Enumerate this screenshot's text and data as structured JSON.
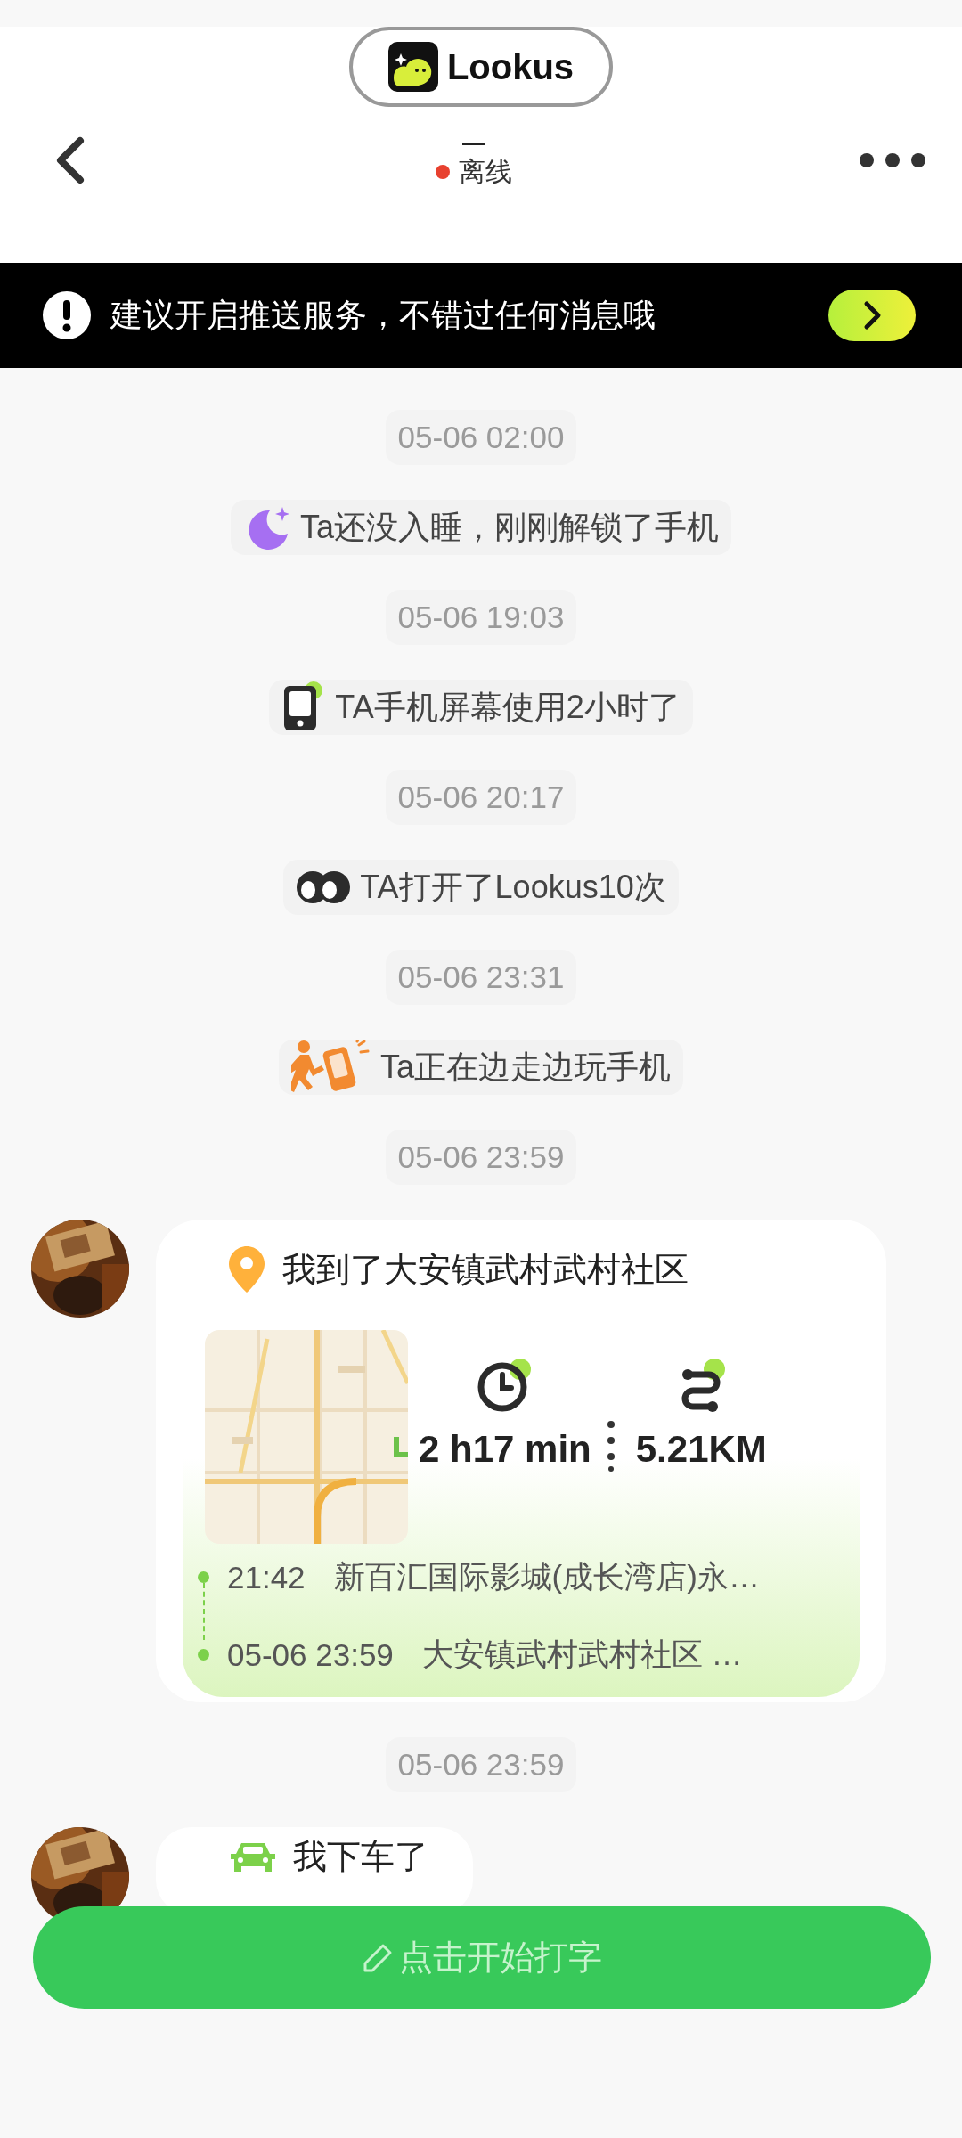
{
  "app_badge": {
    "name": "Lookus"
  },
  "header": {
    "contact_name": "—",
    "status": "离线",
    "online": false
  },
  "banner": {
    "text": "建议开启推送服务，不错过任何消息哦"
  },
  "feed": [
    {
      "kind": "time",
      "text": "05-06 02:00"
    },
    {
      "kind": "sleep",
      "text": "Ta还没入睡，刚刚解锁了手机"
    },
    {
      "kind": "time",
      "text": "05-06 19:03"
    },
    {
      "kind": "screen",
      "text": "TA手机屏幕使用2小时了"
    },
    {
      "kind": "time",
      "text": "05-06 20:17"
    },
    {
      "kind": "opens",
      "text": "TA打开了Lookus10次"
    },
    {
      "kind": "time",
      "text": "05-06 23:31"
    },
    {
      "kind": "walking",
      "text": "Ta正在边走边玩手机"
    },
    {
      "kind": "time",
      "text": "05-06 23:59"
    },
    {
      "kind": "trip",
      "title": "我到了大安镇武村武村社区",
      "duration": "2 h17 min",
      "distance": "5.21KM",
      "route": [
        {
          "time": "21:42",
          "place": "新百汇国际影城(成长湾店)永…"
        },
        {
          "time": "05-06 23:59",
          "place": "大安镇武村武村社区 …"
        }
      ]
    },
    {
      "kind": "time",
      "text": "05-06 23:59"
    },
    {
      "kind": "car",
      "text": "我下车了"
    }
  ],
  "compose_button": {
    "label": "点击开始打字"
  }
}
